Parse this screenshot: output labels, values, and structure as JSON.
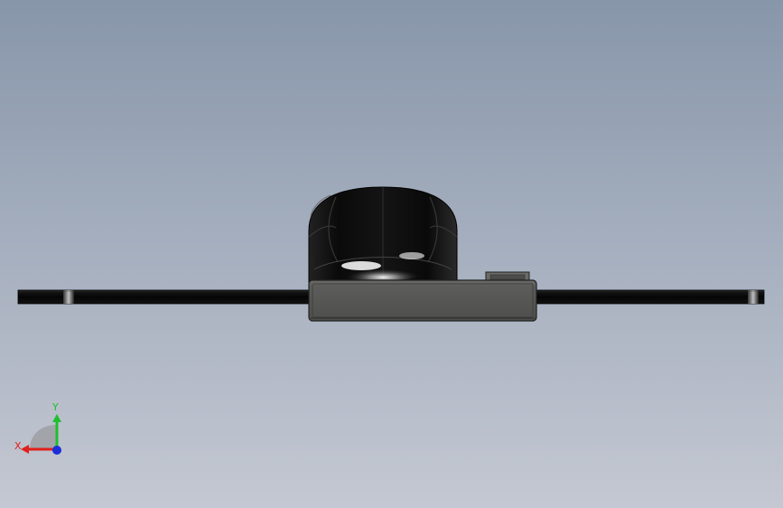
{
  "viewport": {
    "background_top": "#8896aa",
    "background_bottom": "#c4c8d2"
  },
  "model": {
    "parts": [
      "bar-plate",
      "dome-housing",
      "box-base",
      "connector-tab"
    ],
    "colors": {
      "bar": "#0a0a0a",
      "dome": "#0d0d0d",
      "box": "#5a5a58",
      "box_edge": "#2a2a2a"
    }
  },
  "triad": {
    "x_label": "X",
    "y_label": "Y",
    "x_color": "#e0201c",
    "y_color": "#1fbf2f",
    "z_color": "#1a2fd8"
  }
}
